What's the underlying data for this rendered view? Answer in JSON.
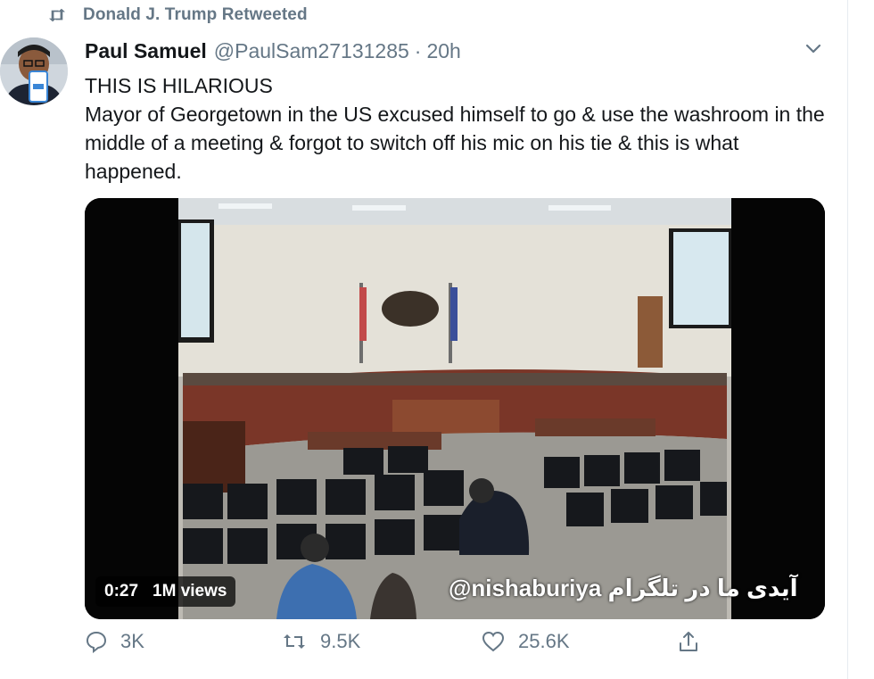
{
  "retweet": {
    "label": "Donald J. Trump Retweeted",
    "icon": "retweet-icon"
  },
  "author": {
    "name": "Paul Samuel",
    "handle": "@PaulSam27131285",
    "separator": "·",
    "time": "20h"
  },
  "tweet": {
    "line1": "THIS IS HILARIOUS",
    "line2": "Mayor of Georgetown in the US excused himself to go & use the washroom in the middle of a meeting & forgot to switch off his mic on his tie & this is what happened."
  },
  "media": {
    "duration": "0:27",
    "views": "1M views",
    "watermark": "@nishaburiya آیدی ما در تلگرام"
  },
  "actions": {
    "replies": "3K",
    "retweets": "9.5K",
    "likes": "25.6K"
  },
  "colors": {
    "secondary": "#657786",
    "text": "#14171a",
    "border": "#e6ecf0"
  }
}
